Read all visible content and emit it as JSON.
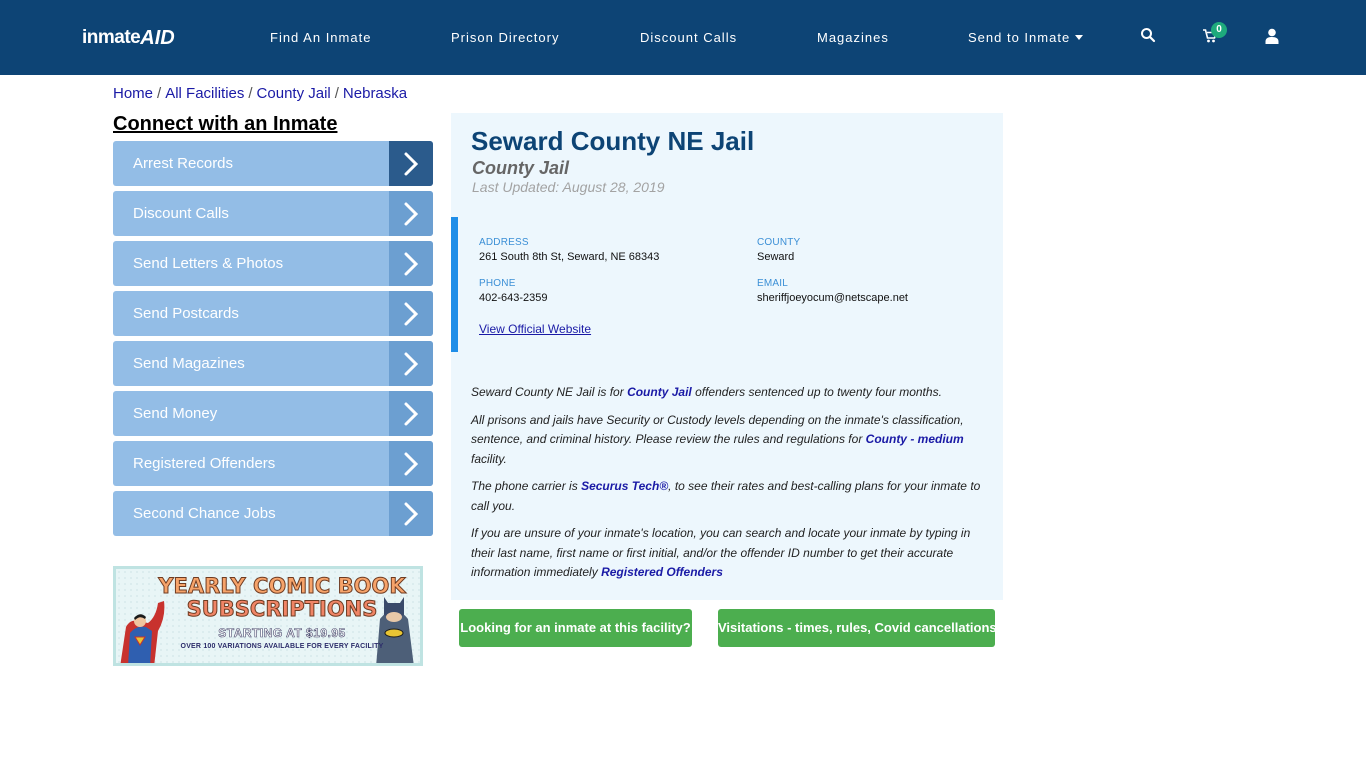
{
  "header": {
    "logo": {
      "part1": "inmate",
      "part2": "AID"
    },
    "nav": [
      {
        "label": "Find An Inmate"
      },
      {
        "label": "Prison Directory"
      },
      {
        "label": "Discount Calls"
      },
      {
        "label": "Magazines"
      },
      {
        "label": "Send to Inmate",
        "has_dropdown": true
      }
    ],
    "icons": {
      "search": "search-icon",
      "cart": "cart-icon",
      "user": "user-icon"
    },
    "cart_count": "0"
  },
  "breadcrumb": [
    {
      "label": "Home"
    },
    {
      "label": "All Facilities"
    },
    {
      "label": "County Jail"
    },
    {
      "label": "Nebraska"
    }
  ],
  "breadcrumb_separator": "/",
  "sidebar": {
    "title": "Connect with an Inmate",
    "items": [
      {
        "label": "Arrest Records",
        "active": true
      },
      {
        "label": "Discount Calls"
      },
      {
        "label": "Send Letters & Photos"
      },
      {
        "label": "Send Postcards"
      },
      {
        "label": "Send Magazines"
      },
      {
        "label": "Send Money"
      },
      {
        "label": "Registered Offenders"
      },
      {
        "label": "Second Chance Jobs"
      }
    ],
    "ad": {
      "line1": "YEARLY COMIC BOOK",
      "line2": "SUBSCRIPTIONS",
      "line3": "STARTING AT $19.95",
      "line4": "OVER 100 VARIATIONS AVAILABLE FOR EVERY FACILITY"
    }
  },
  "facility": {
    "name": "Seward County NE Jail",
    "type": "County Jail",
    "last_updated": "Last Updated: August 28, 2019",
    "address_label": "ADDRESS",
    "address": "261 South 8th St, Seward, NE 68343",
    "county_label": "COUNTY",
    "county": "Seward",
    "phone_label": "PHONE",
    "phone": "402-643-2359",
    "email_label": "EMAIL",
    "email": "sheriffjoeyocum@netscape.net",
    "website_link": "View Official Website"
  },
  "description": {
    "p1_pre": "Seward County NE Jail is for ",
    "p1_link": "County Jail",
    "p1_post": " offenders sentenced up to twenty four months.",
    "p2_pre": "All prisons and jails have Security or Custody levels depending on the inmate's classification, sentence, and criminal history. Please review the rules and regulations for ",
    "p2_link": "County - medium",
    "p2_post": " facility.",
    "p3_pre": "The phone carrier is ",
    "p3_link": "Securus Tech®",
    "p3_post": ", to see their rates and best-calling plans for your inmate to call you.",
    "p4_pre": "If you are unsure of your inmate's location, you can search and locate your inmate by typing in their last name, first name or first initial, and/or the offender ID number to get their accurate information immediately ",
    "p4_link": "Registered Offenders"
  },
  "actions": {
    "find_inmate": "Looking for an inmate at this facility?",
    "visitation": "Visitations - times, rules, Covid cancellations"
  },
  "colors": {
    "navbar": "#0d4475",
    "sidebar_button": "#93bde6",
    "sidebar_arrow": "#6c9fd1",
    "sidebar_arrow_active": "#2b5b8c",
    "panel_bg": "#edf7fd",
    "accent_bar": "#1f8ee8",
    "green_button": "#4cae4f",
    "link": "#1a1aa6"
  }
}
